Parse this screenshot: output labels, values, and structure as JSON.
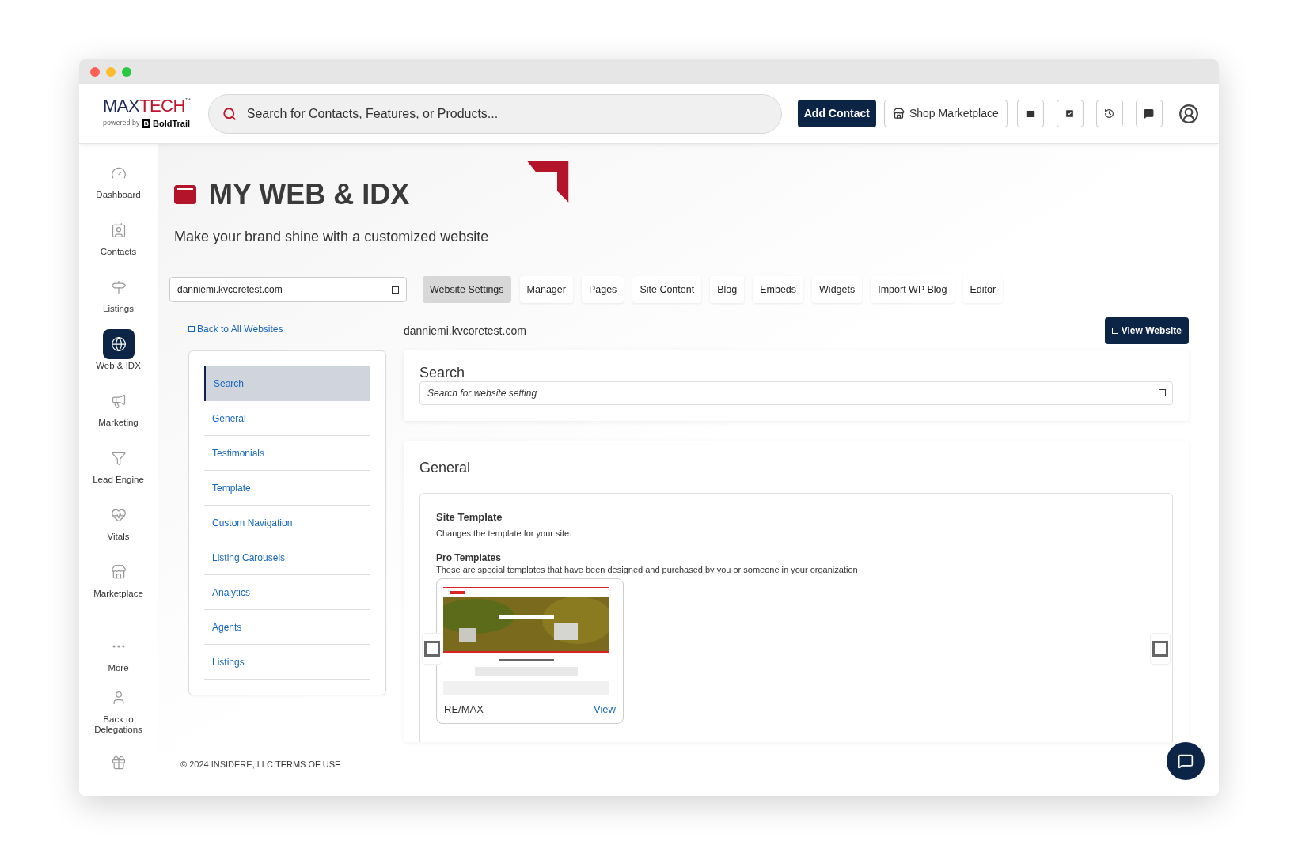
{
  "header": {
    "logo": {
      "brand_first": "MAX",
      "brand_second": "TECH",
      "tm": "™",
      "powered_by": "powered by",
      "partner_mark": "B",
      "partner": "BoldTrail"
    },
    "search": {
      "placeholder": "Search for Contacts, Features, or Products..."
    },
    "buttons": [
      {
        "label": "Add Contact",
        "kind": "primary"
      },
      {
        "label": "Shop Marketplace",
        "kind": "outline"
      }
    ]
  },
  "sidebar": {
    "items": [
      {
        "label": "Dashboard",
        "selected": false
      },
      {
        "label": "Contacts",
        "selected": false
      },
      {
        "label": "Listings",
        "selected": false
      },
      {
        "label": "Web & IDX",
        "selected": true
      },
      {
        "label": "Marketing",
        "selected": false
      },
      {
        "label": "Lead Engine",
        "selected": false
      },
      {
        "label": "Vitals",
        "selected": false
      },
      {
        "label": "Marketplace",
        "selected": false
      },
      {
        "label": "More",
        "selected": false
      },
      {
        "label": "Back to Delegations",
        "selected": false
      }
    ]
  },
  "page": {
    "title": "MY WEB & IDX",
    "subtitle": "Make your brand shine with a customized website"
  },
  "site_select": {
    "value": "danniemi.kvcoretest.com"
  },
  "tabs": [
    {
      "label": "Website Settings",
      "selected": true
    },
    {
      "label": "Manager",
      "selected": false
    },
    {
      "label": "Pages",
      "selected": false
    },
    {
      "label": "Site Content",
      "selected": false
    },
    {
      "label": "Blog",
      "selected": false
    },
    {
      "label": "Embeds",
      "selected": false
    },
    {
      "label": "Widgets",
      "selected": false
    },
    {
      "label": "Import WP Blog",
      "selected": false
    },
    {
      "label": "Editor",
      "selected": false
    }
  ],
  "back_link": "Back to All Websites",
  "settings_nav": [
    {
      "label": "Search",
      "selected": true
    },
    {
      "label": "General",
      "selected": false
    },
    {
      "label": "Testimonials",
      "selected": false
    },
    {
      "label": "Template",
      "selected": false
    },
    {
      "label": "Custom Navigation",
      "selected": false
    },
    {
      "label": "Listing Carousels",
      "selected": false
    },
    {
      "label": "Analytics",
      "selected": false
    },
    {
      "label": "Agents",
      "selected": false
    },
    {
      "label": "Listings",
      "selected": false
    }
  ],
  "site_domain": "danniemi.kvcoretest.com",
  "view_website": "View Website",
  "search_section": {
    "heading": "Search",
    "placeholder": "Search for website setting"
  },
  "general": {
    "heading": "General",
    "site_template": {
      "title": "Site Template",
      "description": "Changes the template for your site."
    },
    "pro_templates": {
      "title": "Pro Templates",
      "description": "These are special templates that have been designed and purchased by you or someone in your organization"
    },
    "templates": [
      {
        "name": "RE/MAX",
        "action": "View"
      }
    ]
  },
  "footer": {
    "copyright": "© 2024 INSIDERE, LLC",
    "link": "TERMS OF USE"
  }
}
